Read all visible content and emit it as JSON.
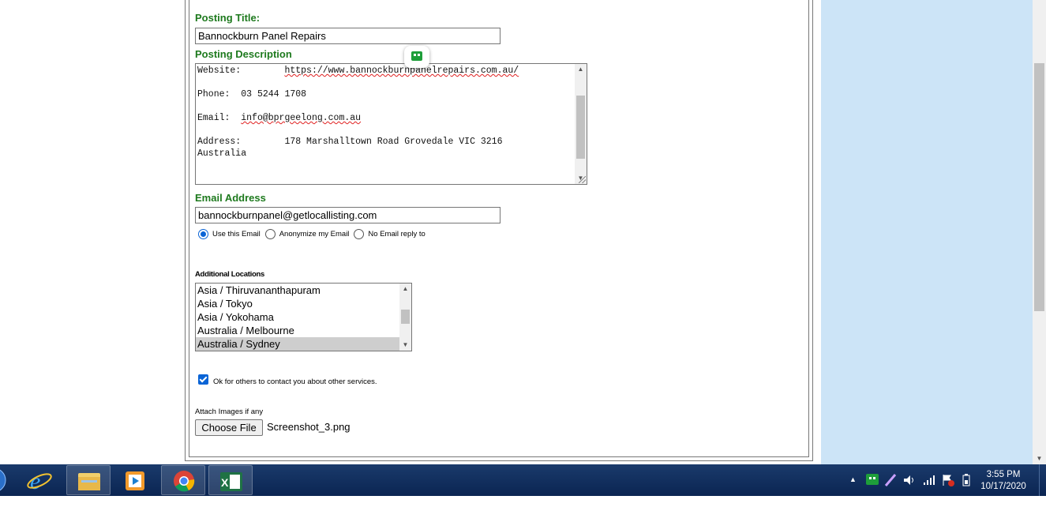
{
  "form": {
    "posting_title_label": "Posting Title:",
    "posting_title_value": "Bannockburn Panel Repairs",
    "posting_description_label": "Posting Description",
    "description": {
      "website_label": "Website:",
      "website_url": "https://www.bannockburnpanelrepairs.com.au/",
      "phone_label": "Phone:",
      "phone_value": "03 5244 1708",
      "email_label": "Email:",
      "email_value": "info@bprgeelong.com.au",
      "address_label": "Address:",
      "address_line1": "178 Marshalltown Road Grovedale VIC 3216",
      "address_line2": "Australia"
    },
    "email_address_label": "Email Address",
    "email_address_value": "bannockburnpanel@getlocallisting.com",
    "email_options": [
      {
        "label": "Use this Email",
        "selected": true
      },
      {
        "label": "Anonymize my Email",
        "selected": false
      },
      {
        "label": "No Email reply to",
        "selected": false
      }
    ],
    "additional_locations_label": "Additional Locations",
    "locations": [
      {
        "label": "Asia / Thiruvananthapuram",
        "selected": false
      },
      {
        "label": "Asia / Tokyo",
        "selected": false
      },
      {
        "label": "Asia / Yokohama",
        "selected": false
      },
      {
        "label": "Australia / Melbourne",
        "selected": false
      },
      {
        "label": "Australia / Sydney",
        "selected": true
      }
    ],
    "contact_ok_label": "Ok for others to contact you about other services.",
    "contact_ok_checked": true,
    "attach_images_label": "Attach Images if any",
    "choose_file_label": "Choose File",
    "chosen_file": "Screenshot_3.png"
  },
  "taskbar": {
    "apps": [
      "start-orb",
      "internet-explorer",
      "file-explorer",
      "media-player",
      "google-chrome",
      "microsoft-excel"
    ],
    "clock_time": "3:55 PM",
    "clock_date": "10/17/2020"
  },
  "colors": {
    "label_green": "#1e7a1e",
    "side_panel": "#cce4f7",
    "taskbar": "#0b2552",
    "accent": "#0a64d6"
  }
}
